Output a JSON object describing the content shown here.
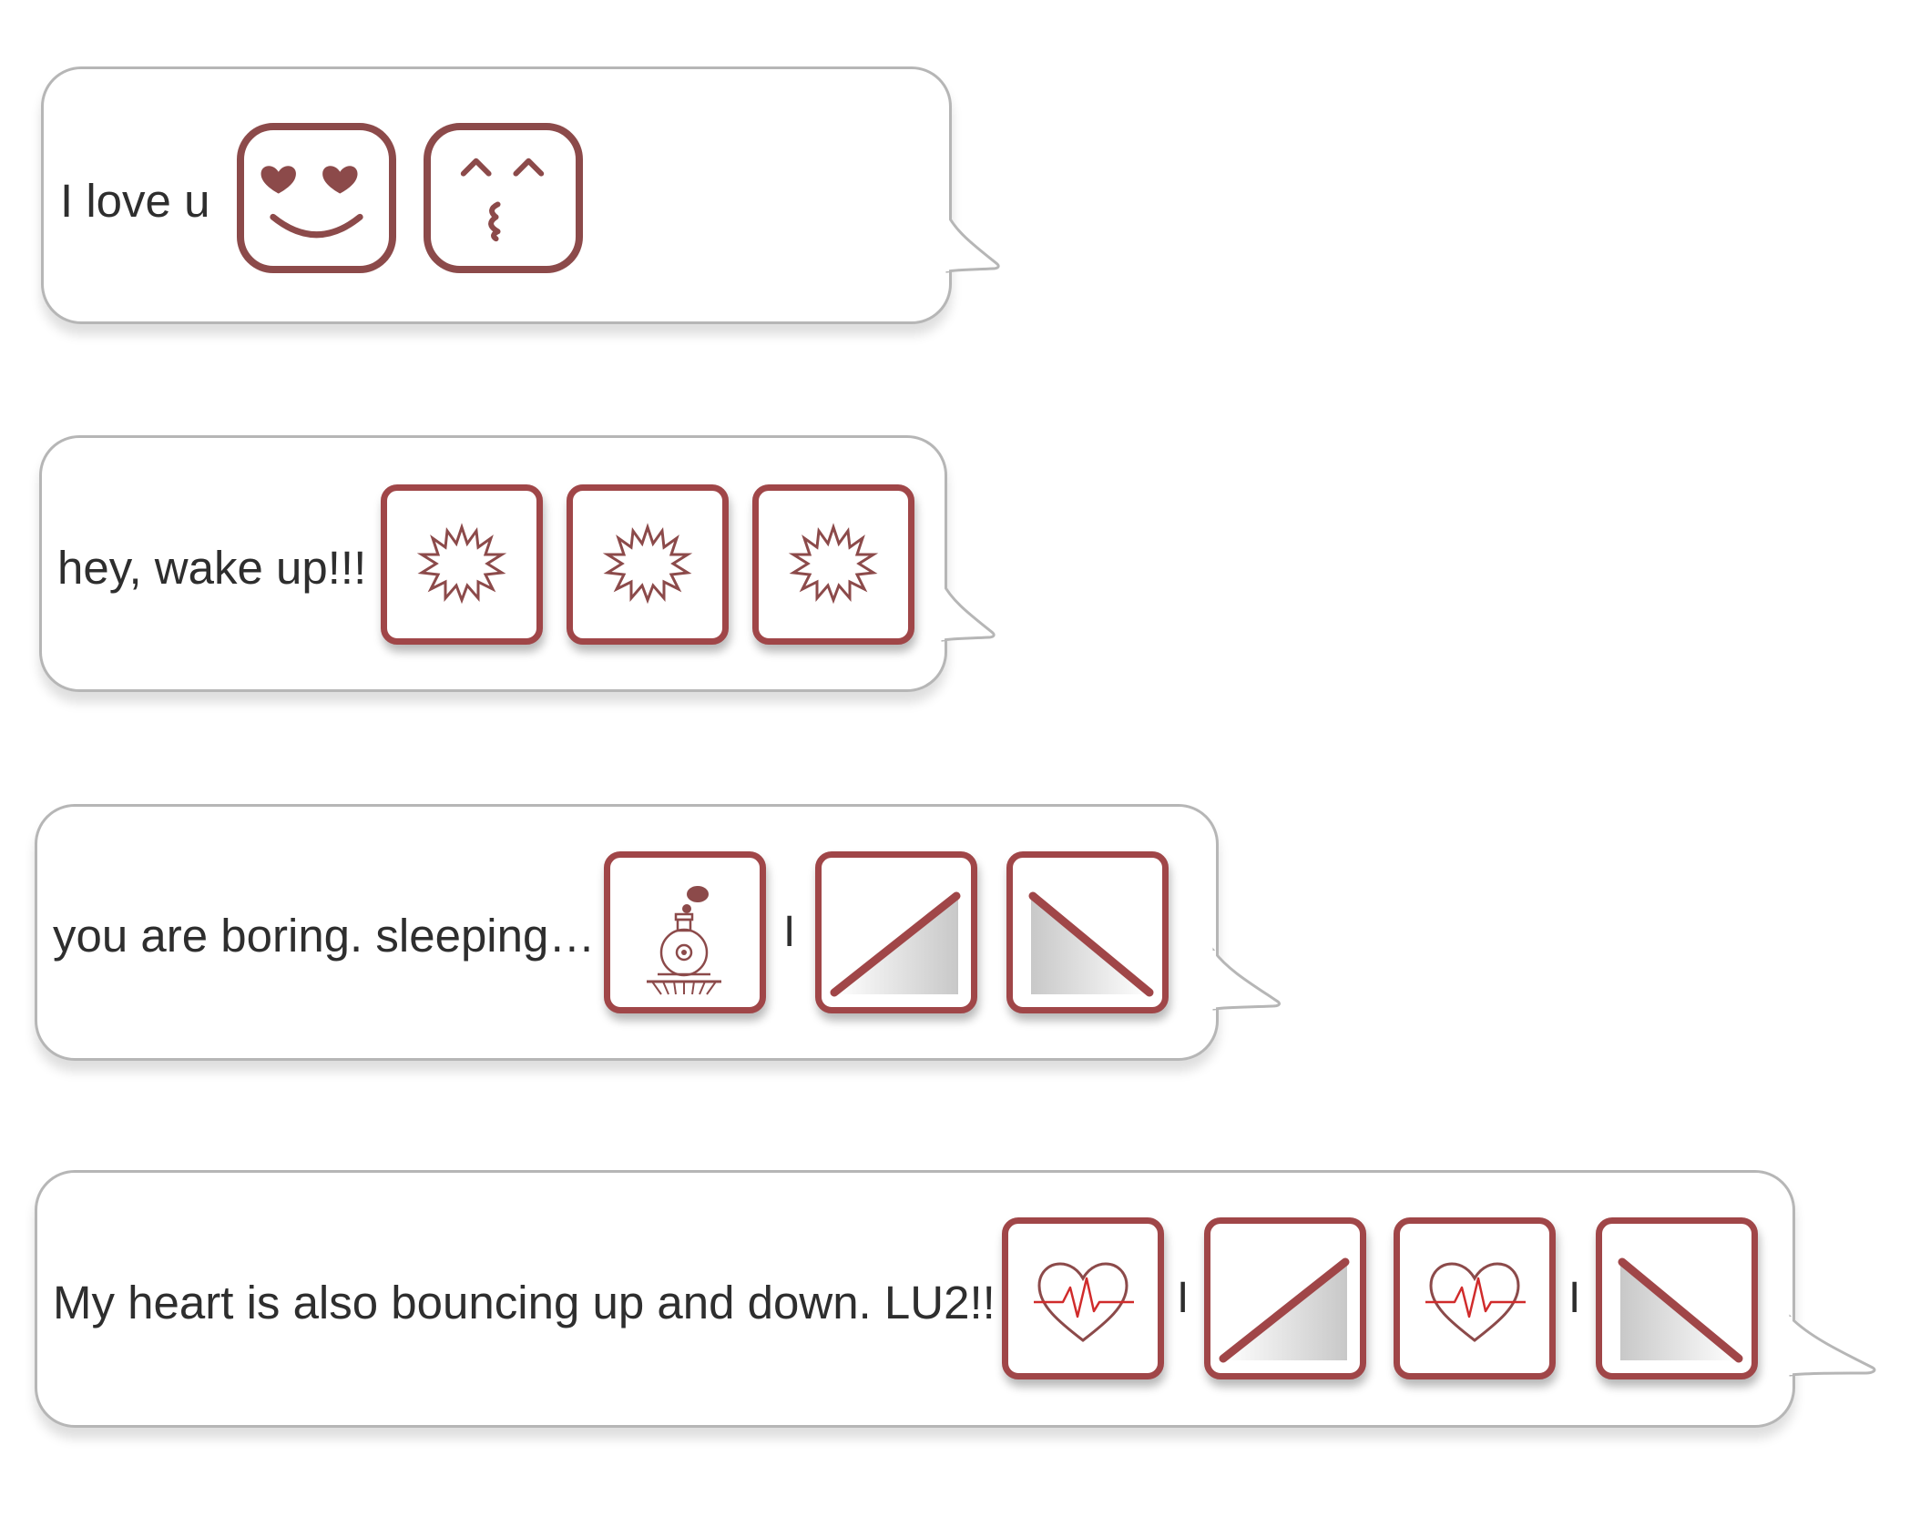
{
  "messages": [
    {
      "text": "I love u",
      "icons": [
        "heart-eyes-face-icon",
        "kissing-face-icon"
      ]
    },
    {
      "text": "hey, wake up!!!",
      "icons": [
        "burst-icon",
        "burst-icon",
        "burst-icon"
      ]
    },
    {
      "text": "you are boring. sleeping…",
      "separator": "I",
      "icons": [
        "steam-train-icon",
        "ramp-up-icon",
        "ramp-down-icon"
      ]
    },
    {
      "text": "My heart is also bouncing up and  down. LU2!!",
      "separator": "I",
      "icons": [
        "heartbeat-icon",
        "ramp-up-icon",
        "heartbeat-icon",
        "ramp-down-icon"
      ]
    }
  ],
  "colors": {
    "tile_border": "#a04648",
    "face_border": "#8c4a4a",
    "bubble_border": "#b6b6b6",
    "text": "#2e2e2e"
  }
}
